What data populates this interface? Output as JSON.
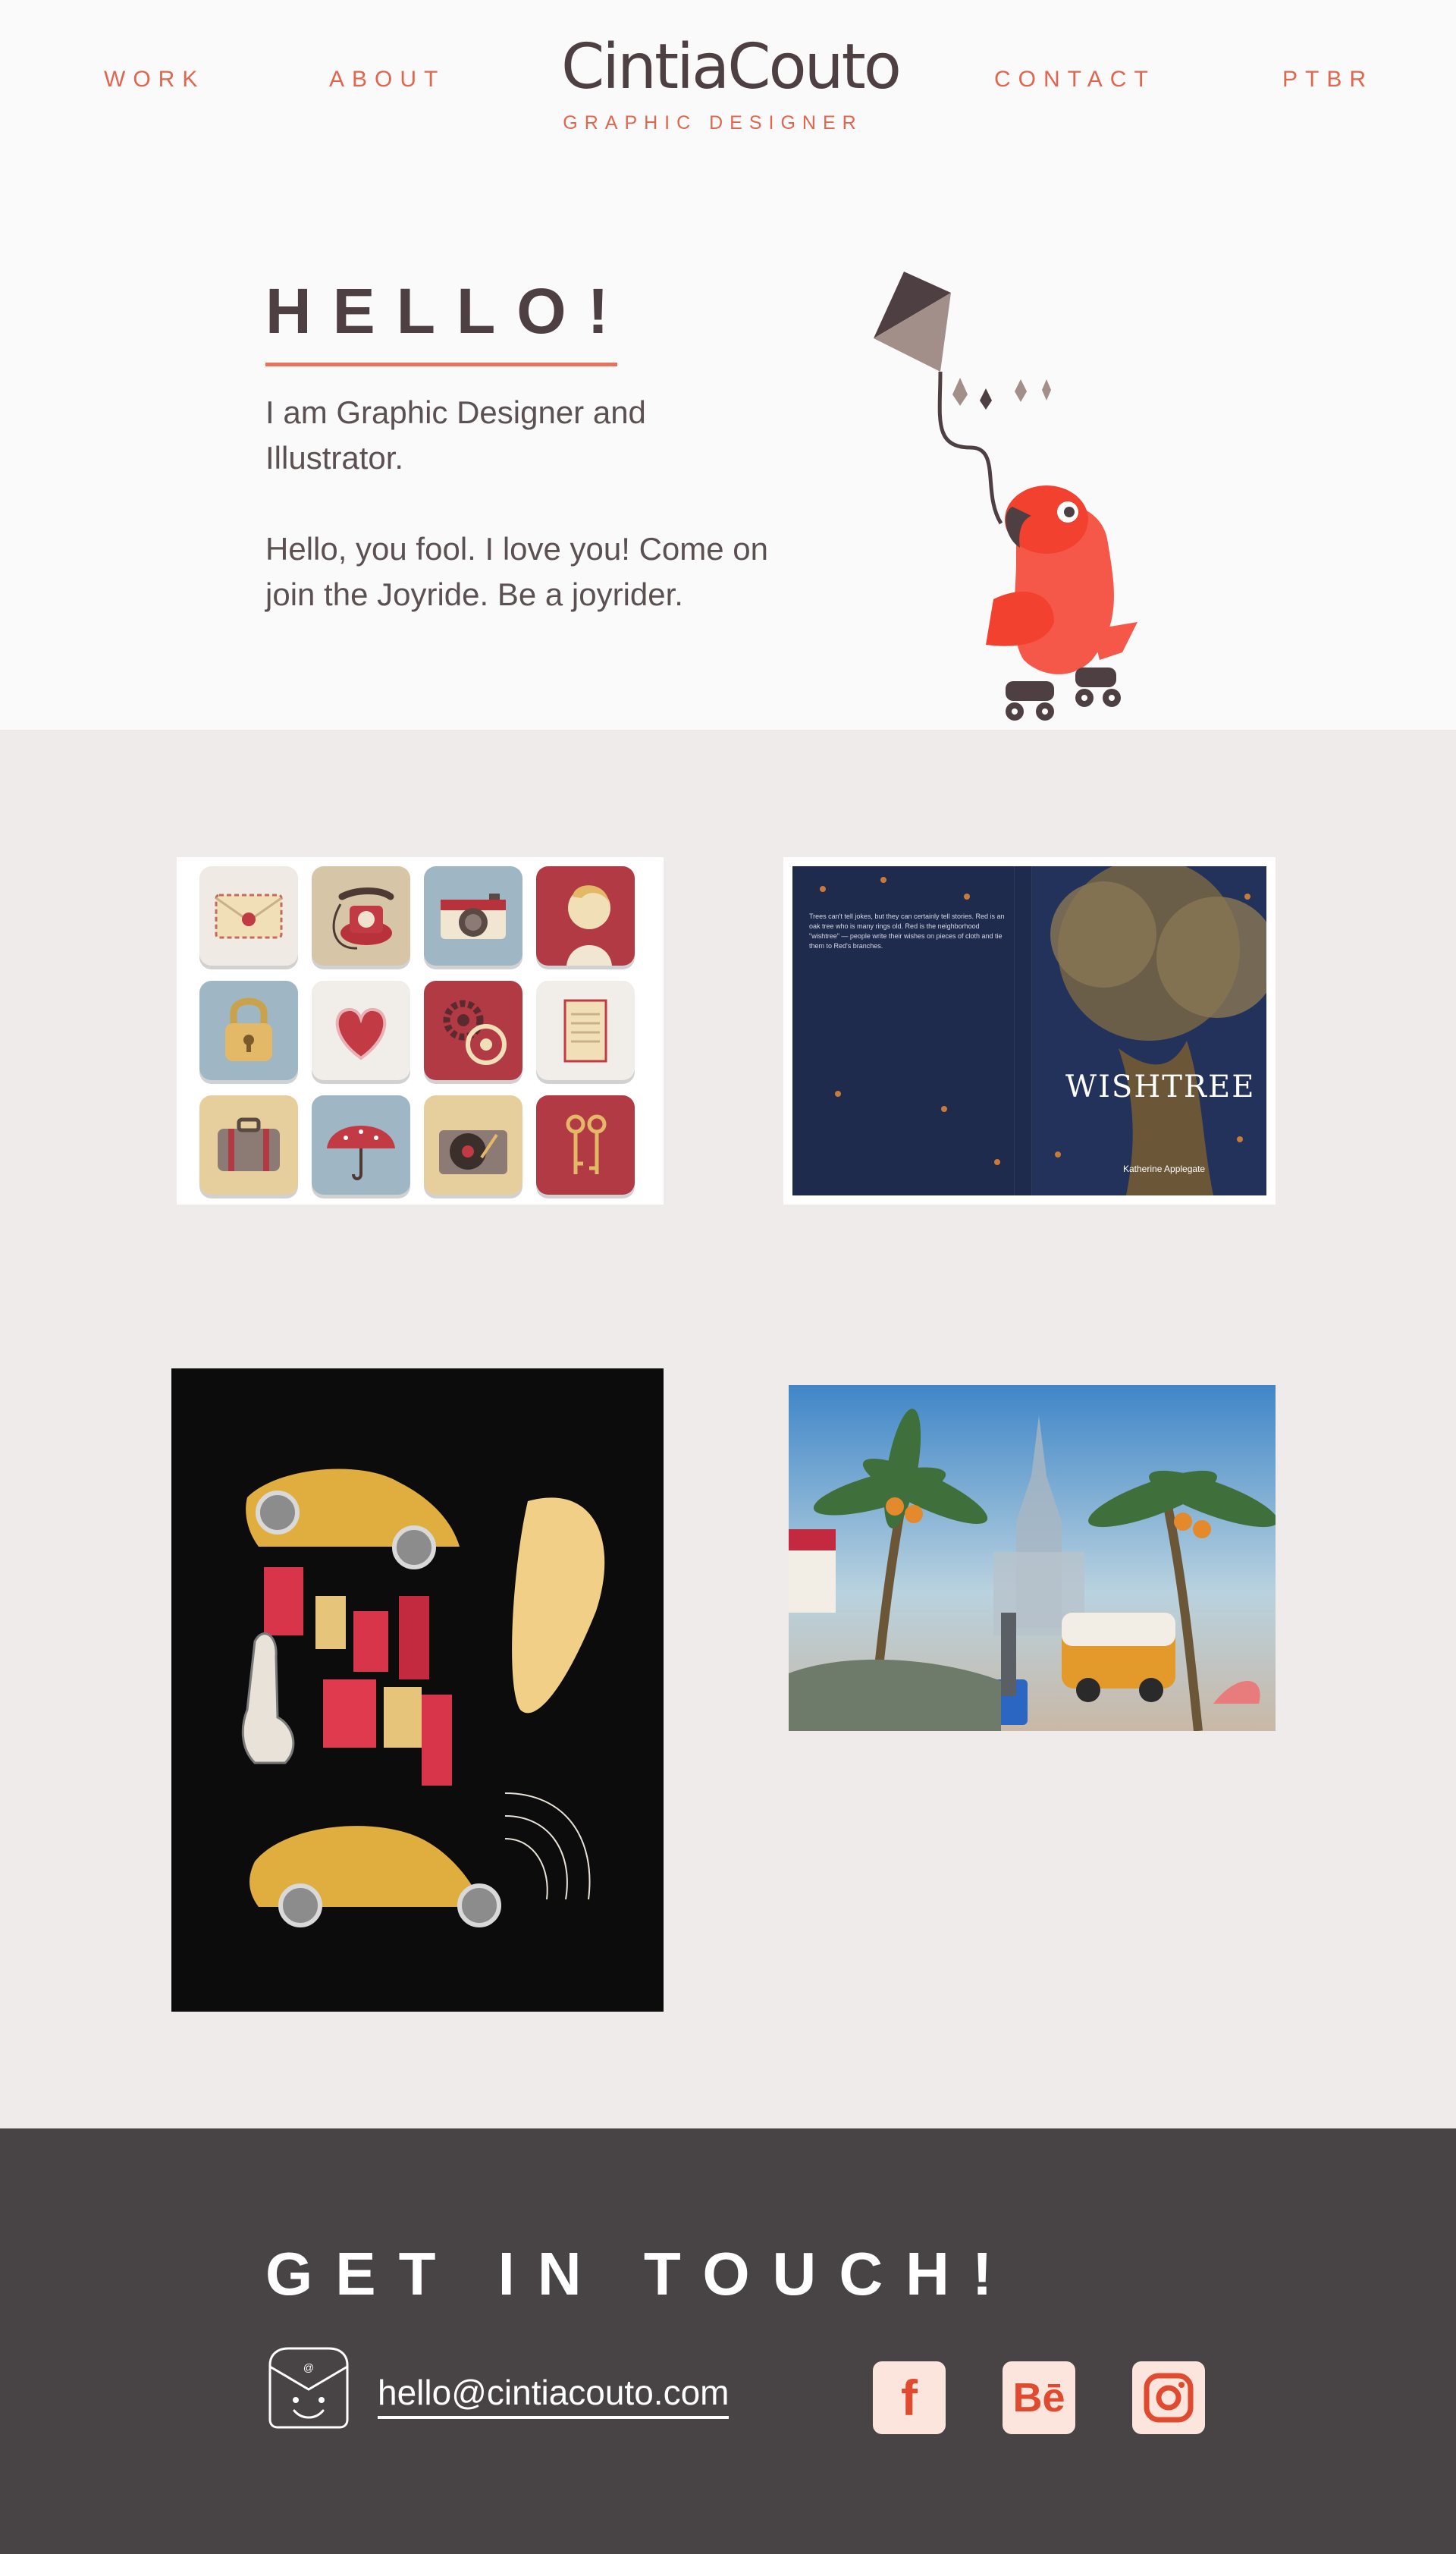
{
  "nav": {
    "work": "WORK",
    "about": "ABOUT",
    "contact": "CONTACT",
    "ptbr": "PTBR"
  },
  "logo": {
    "name": "CintiaCouto",
    "subtitle": "GRAPHIC DESIGNER"
  },
  "hero": {
    "title": "HELLO!",
    "paragraph_1": "I am Graphic Designer and Illustrator.",
    "paragraph_2": "Hello, you fool. I love you! Come on join the Joyride. Be a joyrider."
  },
  "work": {
    "book_title": "WISHTREE",
    "book_back_text": "Trees can't tell jokes, but they can certainly tell stories. Red is an oak tree who is many rings old. Red is the neighborhood \"wishtree\" — people write their wishes on pieces of cloth and tie them to Red's branches.",
    "book_author": "Katherine Applegate"
  },
  "footer": {
    "title": "GET IN TOUCH!",
    "email": "hello@cintiacouto.com"
  },
  "social": {
    "facebook_glyph": "f",
    "behance_glyph": "Bē"
  },
  "colors": {
    "accent": "#e1664e",
    "text_dark": "#4e4042",
    "header_bg": "#fbfafa",
    "page_bg": "#efebea",
    "footer_bg": "#484445",
    "social_bg": "#fce5dc",
    "social_fg": "#e04a2f"
  },
  "icons": {
    "mail": "mail-envelope-smiley-icon",
    "facebook": "facebook-icon",
    "behance": "behance-icon",
    "instagram": "instagram-icon"
  }
}
